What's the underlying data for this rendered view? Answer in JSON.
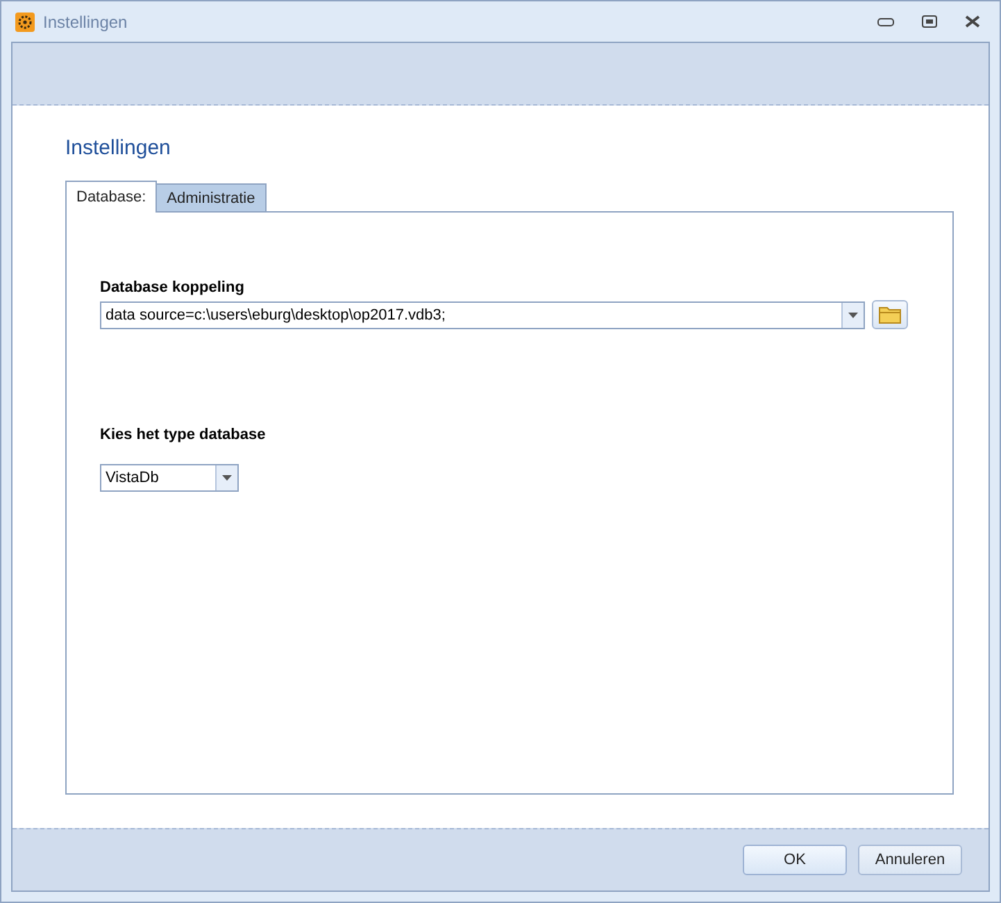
{
  "window": {
    "title": "Instellingen"
  },
  "heading": "Instellingen",
  "tabs": [
    {
      "label": "Database:",
      "selected": true
    },
    {
      "label": "Administratie",
      "selected": false
    }
  ],
  "fields": [
    {
      "label": "Database koppeling",
      "value": "data source=c:\\users\\eburg\\desktop\\op2017.vdb3;",
      "browse": true
    },
    {
      "label": "Kies het type database",
      "value": "VistaDb",
      "browse": false
    }
  ],
  "buttons": [
    "OK",
    "Annuleren"
  ]
}
